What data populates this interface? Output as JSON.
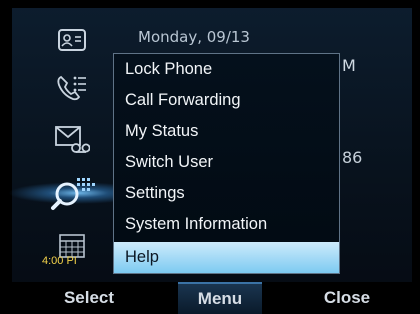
{
  "screen": {
    "date": "Monday, 09/13",
    "partial_text_1": "M",
    "partial_text_2": "86",
    "side_time": "4:00 PI"
  },
  "sidebar": {
    "icons": [
      "contacts-icon",
      "call-log-icon",
      "voicemail-icon",
      "search-icon",
      "calendar-icon"
    ]
  },
  "menu": {
    "items": [
      {
        "label": "Lock Phone"
      },
      {
        "label": "Call Forwarding"
      },
      {
        "label": "My Status"
      },
      {
        "label": "Switch User"
      },
      {
        "label": "Settings"
      },
      {
        "label": "System Information"
      },
      {
        "label": "Help"
      }
    ],
    "selected_index": 6
  },
  "softkeys": {
    "select": "Select",
    "menu": "Menu",
    "close": "Close"
  },
  "colors": {
    "selection": "#8fd2f4",
    "time_text": "#f3d24a",
    "menu_border": "#5f7387"
  }
}
